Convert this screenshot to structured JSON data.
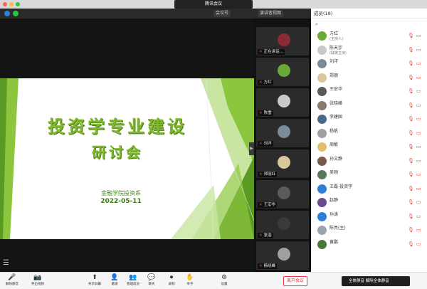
{
  "window": {
    "title": "腾讯会议"
  },
  "topbar": {
    "meeting_id_label": "会议号",
    "view_label": "演讲者视图"
  },
  "slide": {
    "title": "投资学专业建设",
    "subtitle": "研讨会",
    "org": "金融学院投资系",
    "date": "2022-05-11"
  },
  "gallery": {
    "tiles": [
      {
        "name": "正在讲话…",
        "color": "#8b2b33"
      },
      {
        "name": "方红",
        "color": "#6aa83a"
      },
      {
        "name": "陈雪",
        "color": "#c9c9c9"
      },
      {
        "name": "刘洋",
        "color": "#7a8b99"
      },
      {
        "name": "郑丽红",
        "color": "#d8c89a"
      },
      {
        "name": "王宏华",
        "color": "#5a5a5a"
      },
      {
        "name": "张浩",
        "color": "#3a3a3a"
      },
      {
        "name": "杨晓峰",
        "color": "#a0a0a0"
      }
    ]
  },
  "panel": {
    "header": "成员(18)",
    "search_icon": "search-icon",
    "participants": [
      {
        "name": "方红",
        "sub": "(主持人)",
        "color": "#6aa83a"
      },
      {
        "name": "陈天宇",
        "sub": "(联席主持)",
        "color": "#c9c9c9"
      },
      {
        "name": "刘洋",
        "sub": "",
        "color": "#7a8b99"
      },
      {
        "name": "郑丽",
        "sub": "",
        "color": "#d8c89a"
      },
      {
        "name": "王宏华",
        "sub": "",
        "color": "#5a5a5a"
      },
      {
        "name": "张晓峰",
        "sub": "",
        "color": "#8a7a6a"
      },
      {
        "name": "李建国",
        "sub": "",
        "color": "#4a6a8a"
      },
      {
        "name": "杨帆",
        "sub": "",
        "color": "#a0a0a0"
      },
      {
        "name": "周敏",
        "sub": "",
        "color": "#e0c070"
      },
      {
        "name": "孙文静",
        "sub": "",
        "color": "#7a5a4a"
      },
      {
        "name": "吴刚",
        "sub": "",
        "color": "#5a7a5a"
      },
      {
        "name": "王磊-投资学",
        "sub": "",
        "color": "#2f7fd8"
      },
      {
        "name": "赵静",
        "sub": "",
        "color": "#6a4a8a"
      },
      {
        "name": "孙涛",
        "sub": "",
        "color": "#2f7fd8"
      },
      {
        "name": "陈亮(主)",
        "sub": "",
        "color": "#9aa5b0"
      },
      {
        "name": "黄鹏",
        "sub": "",
        "color": "#4a7a3a"
      }
    ]
  },
  "toolbar": {
    "buttons": [
      {
        "label": "解除静音",
        "icon": "🎤"
      },
      {
        "label": "开启视频",
        "icon": "📷"
      },
      {
        "label": "共享屏幕",
        "icon": "⬆"
      },
      {
        "label": "邀请",
        "icon": "👤"
      },
      {
        "label": "管理成员",
        "icon": "👥"
      },
      {
        "label": "聊天",
        "icon": "💬"
      },
      {
        "label": "录制",
        "icon": "⏺"
      },
      {
        "label": "举手",
        "icon": "✋"
      },
      {
        "label": "设置",
        "icon": "⚙"
      }
    ],
    "end_label": "离开会议",
    "panel_footer": "全体静音 解除全体静音"
  }
}
